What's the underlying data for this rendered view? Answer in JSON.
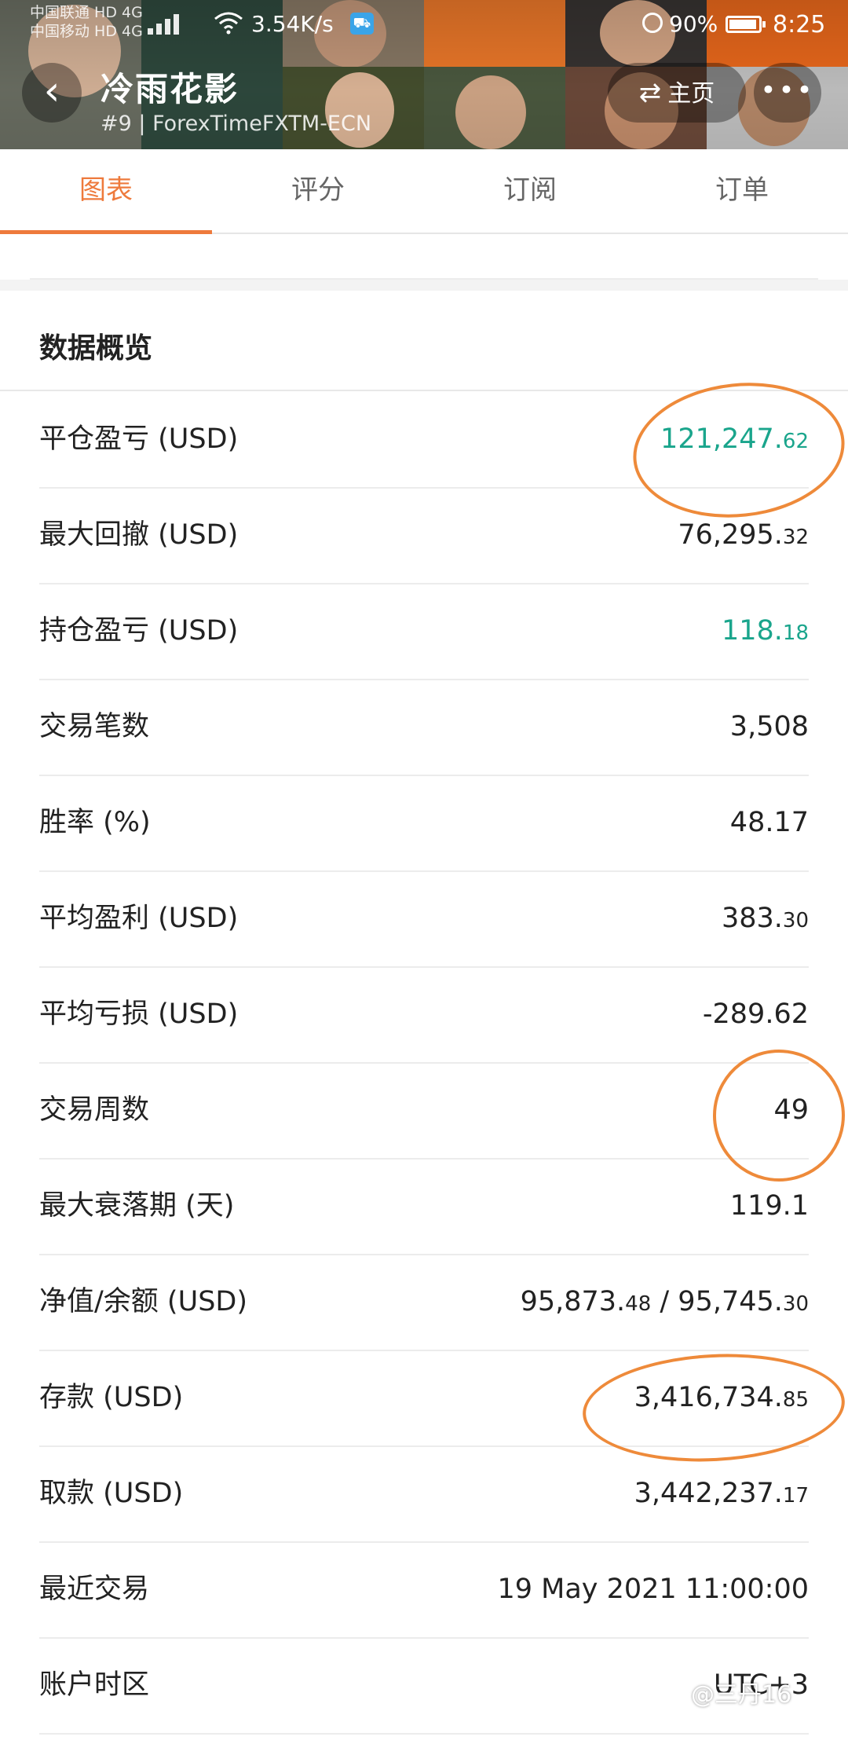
{
  "status_bar": {
    "carrier_1": "中国联通 HD 4G",
    "carrier_2": "中国移动 HD 4G",
    "net_speed": "3.54K/s",
    "battery": "90%",
    "time": "8:25"
  },
  "header": {
    "title": "冷雨花影",
    "subtitle": "#9 | ForexTimeFXTM-ECN",
    "home_label": "主页",
    "more_label": "•••"
  },
  "tabs": [
    "图表",
    "评分",
    "订阅",
    "订单"
  ],
  "section": {
    "title": "数据概览"
  },
  "rows": [
    {
      "label": "平仓盈亏 (USD)",
      "main": "121,247.",
      "small": "62",
      "color": "#1aa58c"
    },
    {
      "label": "最大回撤 (USD)",
      "main": "76,295.",
      "small": "32"
    },
    {
      "label": "持仓盈亏 (USD)",
      "main": "118.",
      "small": "18",
      "color": "#1aa58c"
    },
    {
      "label": "交易笔数",
      "main": "3,508",
      "small": ""
    },
    {
      "label": "胜率 (%)",
      "main": "48.17",
      "small": ""
    },
    {
      "label": "平均盈利 (USD)",
      "main": "383.",
      "small": "30"
    },
    {
      "label": "平均亏损 (USD)",
      "main": "-289.62",
      "small": ""
    },
    {
      "label": "交易周数",
      "main": "49",
      "small": ""
    },
    {
      "label": "最大衰落期 (天)",
      "main": "119.1",
      "small": ""
    },
    {
      "label": "净值/余额 (USD)",
      "main": "95,873.",
      "small": "48",
      "main2": " / 95,745.",
      "small2": "30"
    },
    {
      "label": "存款 (USD)",
      "main": "3,416,734.",
      "small": "85"
    },
    {
      "label": "取款 (USD)",
      "main": "3,442,237.",
      "small": "17"
    },
    {
      "label": "最近交易",
      "main": "19 May 2021 11:00:00",
      "small": ""
    },
    {
      "label": "账户时区",
      "main": "UTC+3",
      "small": ""
    }
  ],
  "watermark": "@三丹16",
  "colors": {
    "accent": "#ee7a3c",
    "profit_green": "#1aa58c",
    "annotation_orange": "#ee8a3a"
  }
}
